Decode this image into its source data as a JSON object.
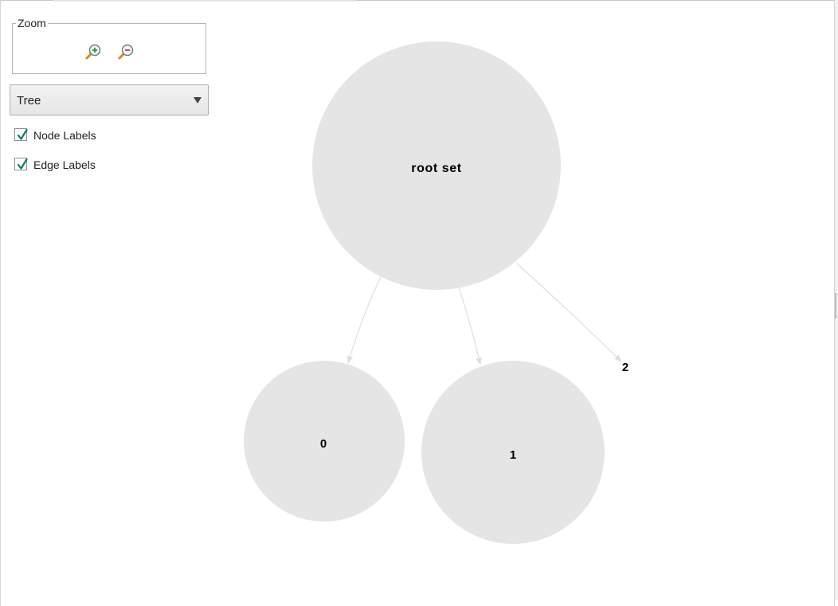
{
  "controls": {
    "zoom_label": "Zoom",
    "zoom_in_icon": "zoom-in-magnifier-icon",
    "zoom_out_icon": "zoom-out-magnifier-icon",
    "layout_selected": "Tree",
    "node_labels": {
      "label": "Node Labels",
      "checked": true
    },
    "edge_labels": {
      "label": "Edge Labels",
      "checked": true
    }
  },
  "graph": {
    "nodes": [
      {
        "id": "root",
        "label": "root set"
      },
      {
        "id": "n0",
        "label": "0"
      },
      {
        "id": "n1",
        "label": "1"
      },
      {
        "id": "n2",
        "label": "2"
      }
    ],
    "edges": [
      {
        "from": "root set",
        "to": "0"
      },
      {
        "from": "root set",
        "to": "1"
      },
      {
        "from": "root set",
        "to": "2"
      }
    ],
    "colors": {
      "node_fill": "#e5e5e5",
      "edge_stroke": "#dedede",
      "label": "#000000"
    }
  }
}
